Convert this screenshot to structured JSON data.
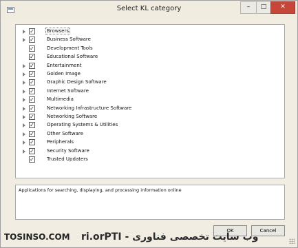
{
  "window": {
    "title": "Select KL category"
  },
  "title_controls": {
    "minimize": "–",
    "maximize": "□",
    "close": "✕"
  },
  "categories": [
    {
      "label": "Browsers",
      "checked": true,
      "expandable": true,
      "selected": true
    },
    {
      "label": "Business Software",
      "checked": true,
      "expandable": true
    },
    {
      "label": "Development Tools",
      "checked": true,
      "expandable": false
    },
    {
      "label": "Educational Software",
      "checked": true,
      "expandable": false
    },
    {
      "label": "Entertainment",
      "checked": true,
      "expandable": true
    },
    {
      "label": "Golden Image",
      "checked": true,
      "expandable": true
    },
    {
      "label": "Graphic Design Software",
      "checked": true,
      "expandable": true
    },
    {
      "label": "Internet Software",
      "checked": true,
      "expandable": true
    },
    {
      "label": "Multimedia",
      "checked": true,
      "expandable": true
    },
    {
      "label": "Networking Infrastructure Software",
      "checked": true,
      "expandable": true
    },
    {
      "label": "Networking Software",
      "checked": true,
      "expandable": true
    },
    {
      "label": "Operating Systems & Utilities",
      "checked": true,
      "expandable": true
    },
    {
      "label": "Other Software",
      "checked": true,
      "expandable": true
    },
    {
      "label": "Peripherals",
      "checked": true,
      "expandable": true
    },
    {
      "label": "Security Software",
      "checked": true,
      "expandable": true
    },
    {
      "label": "Trusted Updaters",
      "checked": true,
      "expandable": false
    }
  ],
  "description": "Applications for searching, displaying, and processing information online",
  "buttons": {
    "ok": "OK",
    "cancel": "Cancel"
  },
  "watermark": {
    "left": "TOSINSO.COM",
    "right": "وب سایت تخصصی فناوری - ITPro.ir"
  },
  "icons": {
    "expander": "triangle-right-icon",
    "check": "checkmark-icon",
    "app": "window-icon"
  }
}
